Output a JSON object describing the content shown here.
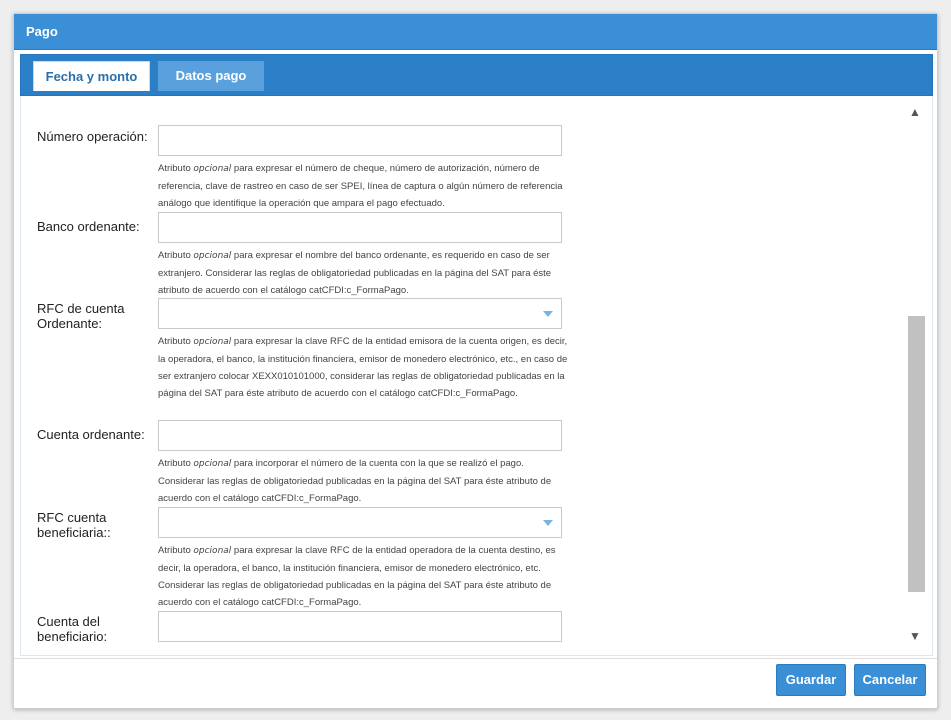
{
  "dialog": {
    "title": "Pago"
  },
  "tabs": [
    {
      "label": "Fecha y monto",
      "active": true
    },
    {
      "label": "Datos pago",
      "active": false
    }
  ],
  "fields": [
    {
      "label": "Número operación:",
      "type": "text",
      "value": "",
      "help_prefix": "Atributo ",
      "help_em": "opcional",
      "help_rest": " para expresar el número de cheque, número de autorización, número de referencia, clave de rastreo en caso de ser SPEI, línea de captura o algún número de referencia análogo que identifique la operación que ampara el pago efectuado."
    },
    {
      "label": "Banco ordenante:",
      "type": "text",
      "value": "",
      "help_prefix": "Atributo ",
      "help_em": "opcional",
      "help_rest": " para expresar el nombre del banco ordenante, es requerido en caso de ser extranjero. Considerar las reglas de obligatoriedad publicadas en la página del SAT para éste atributo de acuerdo con el catálogo catCFDI:c_FormaPago."
    },
    {
      "label": "RFC de cuenta Ordenante:",
      "type": "select",
      "value": "",
      "help_prefix": "Atributo ",
      "help_em": "opcional",
      "help_rest": " para expresar la clave RFC de la entidad emisora de la cuenta origen, es decir, la operadora, el banco, la institución financiera, emisor de monedero electrónico, etc., en caso de ser extranjero colocar XEXX010101000, considerar las reglas de obligatoriedad publicadas en la página del SAT para éste atributo de acuerdo con el catálogo catCFDI:c_FormaPago."
    },
    {
      "label": "Cuenta ordenante:",
      "type": "text",
      "value": "",
      "help_prefix": "Atributo ",
      "help_em": "opcional",
      "help_rest": " para incorporar el número de la cuenta con la que se realizó el pago. Considerar las reglas de obligatoriedad publicadas en la página del SAT para éste atributo de acuerdo con el catálogo catCFDI:c_FormaPago."
    },
    {
      "label": "RFC cuenta beneficiaria::",
      "type": "select",
      "value": "",
      "help_prefix": "Atributo ",
      "help_em": "opcional",
      "help_rest": " para expresar la clave RFC de la entidad operadora de la cuenta destino, es decir, la operadora, el banco, la institución financiera, emisor de monedero electrónico, etc. Considerar las reglas de obligatoriedad publicadas en la página del SAT para éste atributo de acuerdo con el catálogo catCFDI:c_FormaPago."
    },
    {
      "label": "Cuenta del beneficiario:",
      "type": "text",
      "value": ""
    }
  ],
  "scrollbar": {
    "up_icon": "▲",
    "down_icon": "▼"
  },
  "buttons": {
    "save": "Guardar",
    "cancel": "Cancelar"
  }
}
